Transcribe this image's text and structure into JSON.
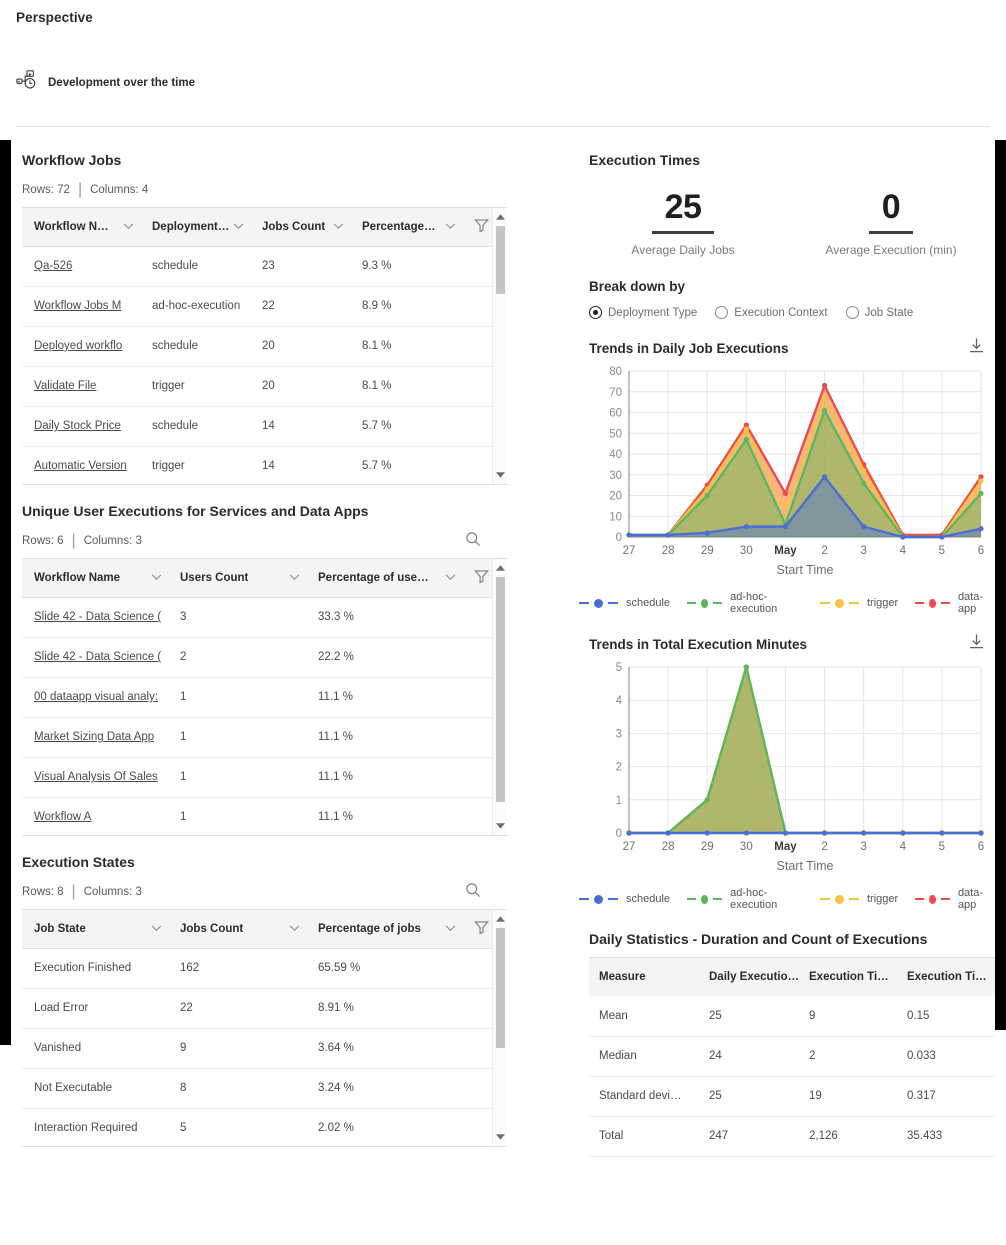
{
  "header": {
    "perspective_title": "Perspective",
    "card_label": "Development over the time",
    "card_icon": "workflow-clock-icon"
  },
  "left": {
    "workflow_jobs": {
      "title": "Workflow Jobs",
      "rows_label": "Rows: 72",
      "columns_label": "Columns: 4",
      "separator": "|",
      "columns": [
        "Workflow N…",
        "Deployment…",
        "Jobs Count",
        "Percentage…"
      ],
      "rows": [
        {
          "name": "Qa-526",
          "deployment": "schedule",
          "count": "23",
          "pct": "9.3 %"
        },
        {
          "name": "Workflow Jobs M",
          "deployment": "ad-hoc-execution",
          "count": "22",
          "pct": "8.9 %"
        },
        {
          "name": "Deployed workflo",
          "deployment": "schedule",
          "count": "20",
          "pct": "8.1 %"
        },
        {
          "name": "Validate File",
          "deployment": "trigger",
          "count": "20",
          "pct": "8.1 %"
        },
        {
          "name": "Daily Stock Price",
          "deployment": "schedule",
          "count": "14",
          "pct": "5.7 %"
        },
        {
          "name": "Automatic Version",
          "deployment": "trigger",
          "count": "14",
          "pct": "5.7 %"
        }
      ]
    },
    "unique_users": {
      "title": "Unique User Executions for Services and Data Apps",
      "rows_label": "Rows: 6",
      "columns_label": "Columns: 3",
      "separator": "|",
      "columns": [
        "Workflow Name",
        "Users Count",
        "Percentage of use…"
      ],
      "rows": [
        {
          "name": "Slide 42 - Data Science (",
          "users": "3",
          "pct": "33.3 %"
        },
        {
          "name": "Slide 42 - Data Science (",
          "users": "2",
          "pct": "22.2 %"
        },
        {
          "name": "00 dataapp visual analy:",
          "users": "1",
          "pct": "11.1 %"
        },
        {
          "name": "Market Sizing Data App",
          "users": "1",
          "pct": "11.1 %"
        },
        {
          "name": "Visual Analysis Of Sales",
          "users": "1",
          "pct": "11.1 %"
        },
        {
          "name": "Workflow A",
          "users": "1",
          "pct": "11.1 %"
        }
      ]
    },
    "execution_states": {
      "title": "Execution States",
      "rows_label": "Rows: 8",
      "columns_label": "Columns: 3",
      "separator": "|",
      "columns": [
        "Job State",
        "Jobs Count",
        "Percentage of jobs"
      ],
      "rows": [
        {
          "state": "Execution Finished",
          "count": "162",
          "pct": "65.59 %"
        },
        {
          "state": "Load Error",
          "count": "22",
          "pct": "8.91 %"
        },
        {
          "state": "Vanished",
          "count": "9",
          "pct": "3.64 %"
        },
        {
          "state": "Not Executable",
          "count": "8",
          "pct": "3.24 %"
        },
        {
          "state": "Interaction Required",
          "count": "5",
          "pct": "2.02 %"
        }
      ]
    }
  },
  "right": {
    "title": "Execution Times",
    "kpis": [
      {
        "value": "25",
        "caption": "Average Daily Jobs"
      },
      {
        "value": "0",
        "caption": "Average Execution (min)"
      }
    ],
    "breakdown": {
      "title": "Break down by",
      "options": [
        {
          "label": "Deployment Type",
          "selected": true
        },
        {
          "label": "Execution Context",
          "selected": false
        },
        {
          "label": "Job State",
          "selected": false
        }
      ]
    },
    "stats": {
      "title": "Daily Statistics - Duration and Count of Executions",
      "columns": [
        "Measure",
        "Daily Executio…",
        "Execution Ti…",
        "Execution Ti…"
      ],
      "rows": [
        {
          "measure": "Mean",
          "c1": "25",
          "c2": "9",
          "c3": "0.15"
        },
        {
          "measure": "Median",
          "c1": "24",
          "c2": "2",
          "c3": "0.033"
        },
        {
          "measure": "Standard devi…",
          "c1": "25",
          "c2": "19",
          "c3": "0.317"
        },
        {
          "measure": "Total",
          "c1": "247",
          "c2": "2,126",
          "c3": "35.433"
        }
      ]
    }
  },
  "colors": {
    "schedule": "#4a6fd4",
    "ad_hoc_execution": "#5cb85c",
    "trigger": "#f5c242",
    "data_app": "#ef4b4b",
    "schedule_fill": "#6b83d8",
    "ad_hoc_fill": "#9fd49a",
    "trigger_fill": "#fbd97a",
    "data_app_fill": "#f8a0a0"
  },
  "chart_data": [
    {
      "type": "area",
      "title": "Trends in Daily Job Executions",
      "xlabel": "Start Time",
      "ylabel": "",
      "ylim": [
        0,
        80
      ],
      "yticks": [
        0,
        10,
        20,
        30,
        40,
        50,
        60,
        70,
        80
      ],
      "grid": true,
      "legend_position": "bottom",
      "stacked": true,
      "categories": [
        "27",
        "28",
        "29",
        "30",
        "May",
        "2",
        "3",
        "4",
        "5",
        "6"
      ],
      "series": [
        {
          "name": "schedule",
          "color": "#4a6fd4",
          "values": [
            1,
            1,
            2,
            5,
            5,
            29,
            5,
            0,
            0,
            4
          ]
        },
        {
          "name": "ad-hoc-execution",
          "color": "#5cb85c",
          "values": [
            1,
            1,
            20,
            47,
            6,
            61,
            26,
            0,
            0,
            21
          ]
        },
        {
          "name": "trigger",
          "color": "#f5c242",
          "values": [
            1,
            1,
            23,
            52,
            15,
            68,
            32,
            0,
            0,
            27
          ]
        },
        {
          "name": "data-app",
          "color": "#ef4b4b",
          "values": [
            1,
            1,
            25,
            54,
            21,
            73,
            35,
            1,
            1,
            29
          ]
        }
      ],
      "download_icon": "download-icon"
    },
    {
      "type": "area",
      "title": "Trends in Total Execution Minutes",
      "xlabel": "Start Time",
      "ylabel": "",
      "ylim": [
        0,
        5
      ],
      "yticks": [
        0,
        1,
        2,
        3,
        4,
        5
      ],
      "grid": true,
      "legend_position": "bottom",
      "stacked": true,
      "categories": [
        "27",
        "28",
        "29",
        "30",
        "May",
        "2",
        "3",
        "4",
        "5",
        "6"
      ],
      "series": [
        {
          "name": "schedule",
          "color": "#4a6fd4",
          "values": [
            0,
            0,
            0,
            0,
            0,
            0,
            0,
            0,
            0,
            0
          ]
        },
        {
          "name": "ad-hoc-execution",
          "color": "#5cb85c",
          "values": [
            0,
            0,
            1,
            5,
            0,
            0,
            0,
            0,
            0,
            0
          ]
        },
        {
          "name": "trigger",
          "color": "#f5c242",
          "values": [
            0,
            0,
            1,
            5,
            0,
            0,
            0,
            0,
            0,
            0
          ]
        },
        {
          "name": "data-app",
          "color": "#ef4b4b",
          "values": [
            0,
            0,
            1,
            5,
            0,
            0,
            0,
            0,
            0,
            0
          ]
        }
      ],
      "download_icon": "download-icon"
    }
  ],
  "legend_items": [
    "schedule",
    "ad-hoc-execution",
    "trigger",
    "data-app"
  ]
}
